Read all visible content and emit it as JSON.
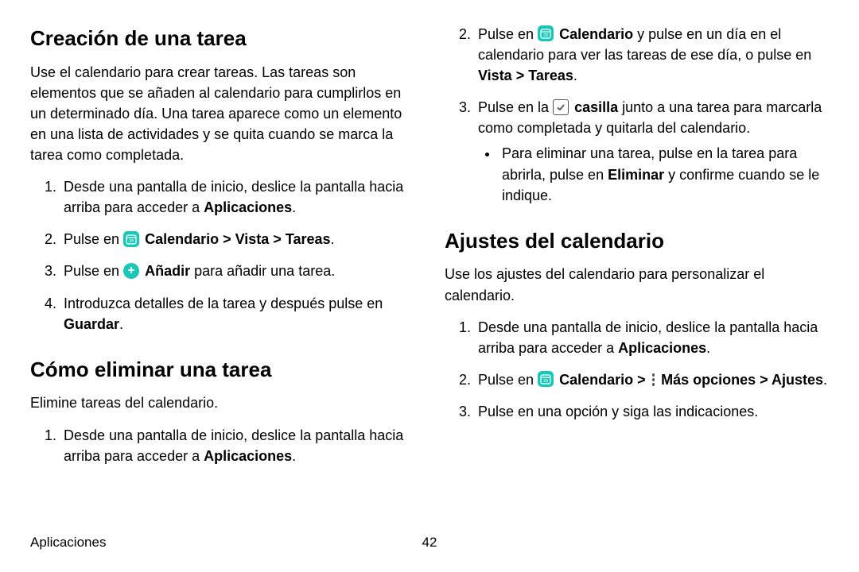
{
  "footer": {
    "section": "Aplicaciones",
    "page": "42"
  },
  "left": {
    "h1": "Creación de una tarea",
    "intro": "Use el calendario para crear tareas. Las tareas son elementos que se añaden al calendario para cumplirlos en un determinado día. Una tarea aparece como un elemento en una lista de actividades y se quita cuando se marca la tarea como completada.",
    "s1a": "Desde una pantalla de inicio, deslice la pantalla hacia arriba para acceder a ",
    "s1b": "Aplicaciones",
    "s1c": ".",
    "s2a": "Pulse en ",
    "s2b": "Calendario > Vista > Tareas",
    "s2c": ".",
    "s3a": "Pulse en ",
    "s3b": "Añadir",
    "s3c": " para añadir una tarea.",
    "s4a": "Introduzca detalles de la tarea y después pulse en ",
    "s4b": "Guardar",
    "s4c": ".",
    "h2": "Cómo eliminar una tarea",
    "intro2": "Elimine tareas del calendario.",
    "d1a": "Desde una pantalla de inicio, deslice la pantalla hacia arriba para acceder a ",
    "d1b": "Aplicaciones",
    "d1c": "."
  },
  "right": {
    "d2a": "Pulse en ",
    "d2b": "Calendario",
    "d2c": " y pulse en un día en el calendario para ver las tareas de ese día, o pulse en ",
    "d2d": "Vista > Tareas",
    "d2e": ".",
    "d3a": "Pulse en la ",
    "d3b": "casilla",
    "d3c": " junto a una tarea para marcarla como completada y quitarla del calendario.",
    "bullet_a": "Para eliminar una tarea, pulse en la tarea para abrirla, pulse en ",
    "bullet_b": "Eliminar",
    "bullet_c": " y confirme cuando se le indique.",
    "h3": "Ajustes del calendario",
    "intro3": "Use los ajustes del calendario para personalizar el calendario.",
    "a1a": "Desde una pantalla de inicio, deslice la pantalla hacia arriba para acceder a ",
    "a1b": "Aplicaciones",
    "a1c": ".",
    "a2a": "Pulse en ",
    "a2b": "Calendario > ",
    "a2c": "Más opciones > Ajustes",
    "a2d": ".",
    "a3": "Pulse en una opción y siga las indicaciones."
  }
}
